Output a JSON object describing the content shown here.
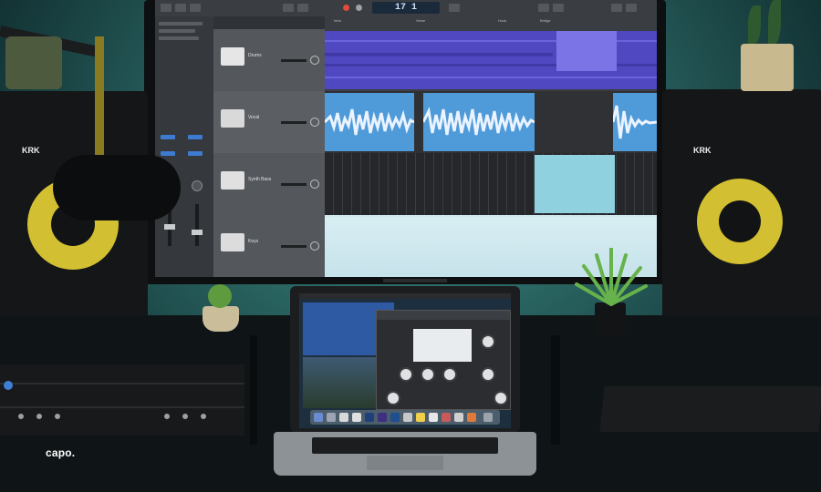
{
  "daw": {
    "lcd_readout": "17 1",
    "region_labels": [
      "Intro",
      "Verse",
      "Hook",
      "Bridge"
    ],
    "tracks": [
      {
        "name": "Drums"
      },
      {
        "name": "Vocal"
      },
      {
        "name": "Synth Bass"
      },
      {
        "name": "Keys"
      }
    ]
  },
  "speakers": {
    "left_brand": "KRK",
    "right_brand": "KRK"
  },
  "watermark": {
    "text": "capo."
  },
  "colors": {
    "accent_purple": "#5a52c8",
    "audio_blue": "#4f9ad8",
    "midi_cyan": "#8fd1de",
    "speaker_yellow": "#d2bf32",
    "ambient_teal": "#3f8e8a"
  }
}
